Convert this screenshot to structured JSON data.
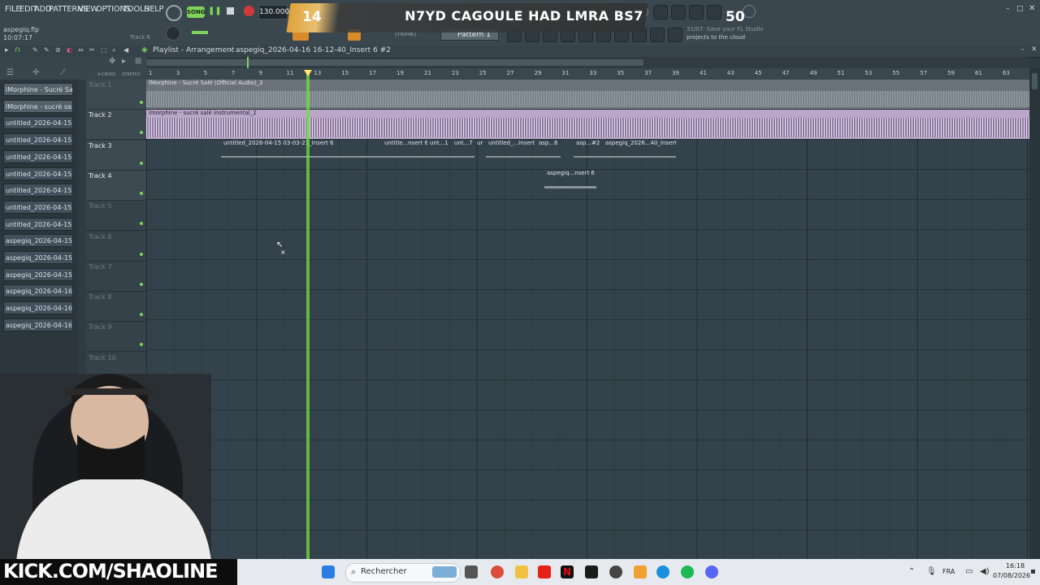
{
  "menu": [
    "FILE",
    "EDIT",
    "ADD",
    "PATTERNS",
    "VIEW",
    "OPTIONS",
    "TOOLS",
    "HELP"
  ],
  "project": {
    "filename": "aspegiq.flp",
    "time": "10:07:17",
    "track_hint": "Track 6"
  },
  "transport": {
    "mode": "SONG",
    "tempo": "130.000"
  },
  "overlay": {
    "left_num": "14",
    "text": "N7YD CAGOULE HAD LMRA BS7",
    "right_num": "50"
  },
  "pattern": {
    "none_label": "(none)",
    "pattern_label": "Pattern 1"
  },
  "hint": {
    "line1": "31/07: Save your FL Studio",
    "line2": "projects to the cloud"
  },
  "playlist": {
    "title": "Playlist - Arrangement",
    "breadcrumb": "aspegiq_2026-04-16 16-12-40_Insert 6 #2"
  },
  "tool_labels": {
    "xcross": "X-CROSS",
    "stretch": "STRETCH"
  },
  "browser_items": [
    "lMorphine - Sucré Sa...",
    "lMorphine - sucré sa...",
    "untitled_2026-04-15 03-...",
    "untitled_2026-04-15 03-...",
    "untitled_2026-04-15 03-...",
    "untitled_2026-04-15 03-...",
    "untitled_2026-04-15 03-...",
    "untitled_2026-04-15 03-...",
    "untitled_2026-04-15 03-...",
    "aspegiq_2026-04-15 03-...",
    "aspegiq_2026-04-15 03-...",
    "aspegiq_2026-04-15 03-...",
    "aspegiq_2026-04-16 16-...",
    "aspegiq_2026-04-16 16-...",
    "aspegiq_2026-04-16 16-..."
  ],
  "tracks": [
    "Track 1",
    "Track 2",
    "Track 3",
    "Track 4",
    "Track 5",
    "Track 6",
    "Track 7",
    "Track 8",
    "Track 9",
    "Track 10"
  ],
  "ruler": [
    "1",
    "3",
    "5",
    "7",
    "9",
    "11",
    "13",
    "15",
    "17",
    "19",
    "21",
    "23",
    "25",
    "27",
    "29",
    "31",
    "33",
    "35",
    "37",
    "39",
    "41",
    "43",
    "45",
    "47",
    "49",
    "51",
    "53",
    "55",
    "57",
    "59",
    "61",
    "63"
  ],
  "clips": {
    "track1": "lMorphine - Sucré Salé (Official Audio)_2",
    "track2": "lmorphine - sucré salé instrumental_2",
    "track3a": "untitled_2026-04-15 03-03-21_Insert 6",
    "track3b": "untitle...nsert 6",
    "track3c": "unt...1",
    "track3d": "unt...7",
    "track3e": "ur",
    "track3f": "untitled_...Insert 6",
    "track3g": "asp...6",
    "track3h": "asp...#2",
    "track3i": "aspegiq_2026...40_Insert 6",
    "track4": "aspegiq...nsert 6"
  },
  "stream": {
    "kick": "KICK.COM/SHAOLINE"
  },
  "taskbar": {
    "search": "Rechercher",
    "lang": "FRA",
    "time": "16:18",
    "date": "07/08/2026"
  },
  "colors": {
    "accent_green": "#6fe03e",
    "overlay_orange": "#e0a23a",
    "clip_purple": "#b9a6c8"
  }
}
